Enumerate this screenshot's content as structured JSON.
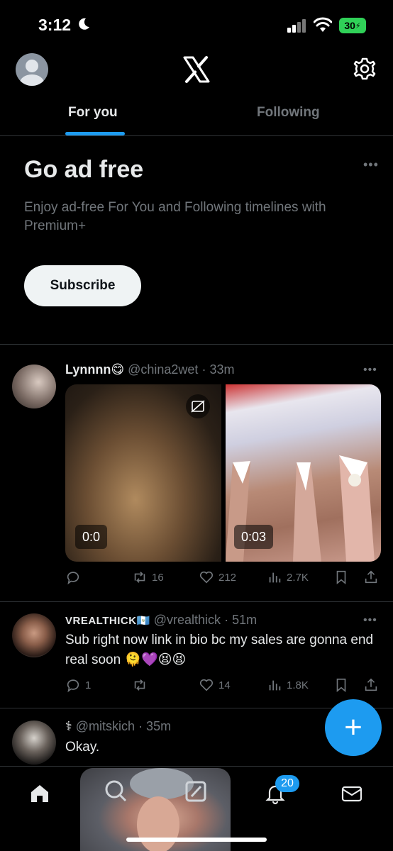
{
  "status_bar": {
    "time": "3:12",
    "battery": "30"
  },
  "header": {
    "logo": "x-logo-icon",
    "settings_icon": "gear-icon",
    "profile_icon": "avatar"
  },
  "tabs": [
    {
      "label": "For you",
      "active": true
    },
    {
      "label": "Following",
      "active": false
    }
  ],
  "promo": {
    "title": "Go ad free",
    "description": "Enjoy ad-free For You and Following timelines with Premium+",
    "button_label": "Subscribe"
  },
  "posts": [
    {
      "name": "Lynnnn😋",
      "handle": "@china2wet",
      "time": "· 33m",
      "text": "",
      "media": [
        {
          "duration": "0:0"
        },
        {
          "duration": "0:03"
        }
      ],
      "replies": "",
      "reposts": "16",
      "likes": "212",
      "views": "2.7K"
    },
    {
      "name": "VREALTHICK🇬🇹",
      "handle": "@vrealthick",
      "time": "· 51m",
      "text": "Sub right now link in bio bc my sales are gonna end real soon 🫠💜😫😫",
      "replies": "1",
      "reposts": "",
      "likes": "14",
      "views": "1.8K"
    },
    {
      "name": "⚕",
      "handle": "@mitskich",
      "time": "· 35m",
      "text": "Okay."
    }
  ],
  "fab": {
    "label": "+"
  },
  "bottom_nav": {
    "notifications_badge": "20"
  },
  "colors": {
    "accent": "#1d9bf0",
    "background": "#000000",
    "muted": "#71767b"
  }
}
